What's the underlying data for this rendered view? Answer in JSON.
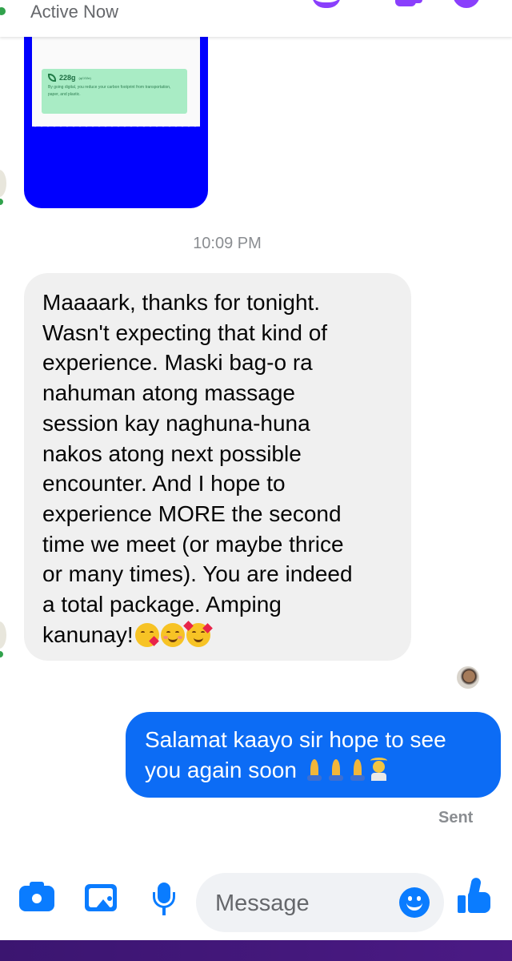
{
  "header": {
    "status": "Active Now",
    "icons": [
      "phone-icon",
      "video-camera-icon",
      "info-icon"
    ],
    "accent_color": "#8a3ffc"
  },
  "receipt_image": {
    "background_color": "#0000ff",
    "carbon_amount": "228g",
    "carbon_unit": "(qCO2e)",
    "carbon_note": "By going digital, you reduce your carbon footprint from transportation, paper, and plastic."
  },
  "thread": {
    "timestamp": "10:09 PM",
    "incoming_message": "Maaaark, thanks for tonight.\nWasn't expecting that kind of\nexperience. Maski bag-o ra\nnahuman atong massage\nsession kay naghuna-huna\nnakos atong next possible\nencounter. And I hope to\nexperience MORE the second\ntime we meet (or maybe thrice\nor many times). You are indeed\na total package. Amping\nkanunay!",
    "incoming_emojis": [
      "kissing-heart-emoji",
      "smiling-emoji",
      "smiling-hearts-emoji"
    ],
    "outgoing_message": "Salamat kaayo sir hope to see\nyou again soon",
    "outgoing_emojis": [
      "folded-hands-emoji",
      "folded-hands-emoji",
      "folded-hands-emoji",
      "man-raising-hands-emoji"
    ],
    "sent_label": "Sent",
    "outgoing_color": "#0c6cf5",
    "incoming_color": "#f0f0f0"
  },
  "composer": {
    "placeholder": "Message",
    "icons": [
      "camera-icon",
      "gallery-icon",
      "microphone-icon",
      "emoji-icon",
      "thumbs-up-icon"
    ],
    "accent_color": "#0a7cff"
  }
}
